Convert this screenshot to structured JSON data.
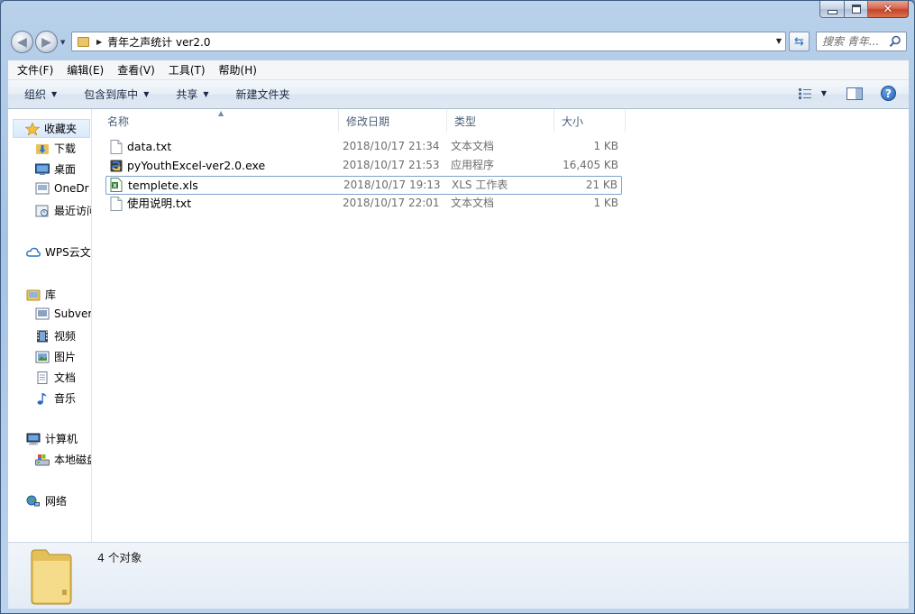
{
  "window": {
    "title": "青年之声统计 ver2.0"
  },
  "address": {
    "path": "青年之声统计 ver2.0"
  },
  "search": {
    "placeholder": "搜索 青年..."
  },
  "menubar": [
    "文件(F)",
    "编辑(E)",
    "查看(V)",
    "工具(T)",
    "帮助(H)"
  ],
  "toolbar": {
    "organize": "组织",
    "include": "包含到库中",
    "share": "共享",
    "new_folder": "新建文件夹"
  },
  "nav": {
    "favorites": "收藏夹",
    "downloads": "下载",
    "desktop": "桌面",
    "onedrive": "OneDr",
    "recent": "最近访问",
    "wps": "WPS云文",
    "libraries": "库",
    "subversion": "Subver",
    "videos": "视频",
    "pictures": "图片",
    "documents": "文档",
    "music": "音乐",
    "computer": "计算机",
    "localdisk": "本地磁盘",
    "network": "网络"
  },
  "columns": {
    "name": "名称",
    "date": "修改日期",
    "type": "类型",
    "size": "大小"
  },
  "files": [
    {
      "name": "data.txt",
      "date": "2018/10/17 21:34",
      "type": "文本文档",
      "size": "1 KB",
      "icon": "text-file-icon"
    },
    {
      "name": "pyYouthExcel-ver2.0.exe",
      "date": "2018/10/17 21:53",
      "type": "应用程序",
      "size": "16,405 KB",
      "icon": "python-exe-icon"
    },
    {
      "name": "templete.xls",
      "date": "2018/10/17 19:13",
      "type": "XLS 工作表",
      "size": "21 KB",
      "icon": "excel-file-icon"
    },
    {
      "name": "使用说明.txt",
      "date": "2018/10/17 22:01",
      "type": "文本文档",
      "size": "1 KB",
      "icon": "text-file-icon"
    }
  ],
  "status": {
    "count": "4 个对象"
  }
}
